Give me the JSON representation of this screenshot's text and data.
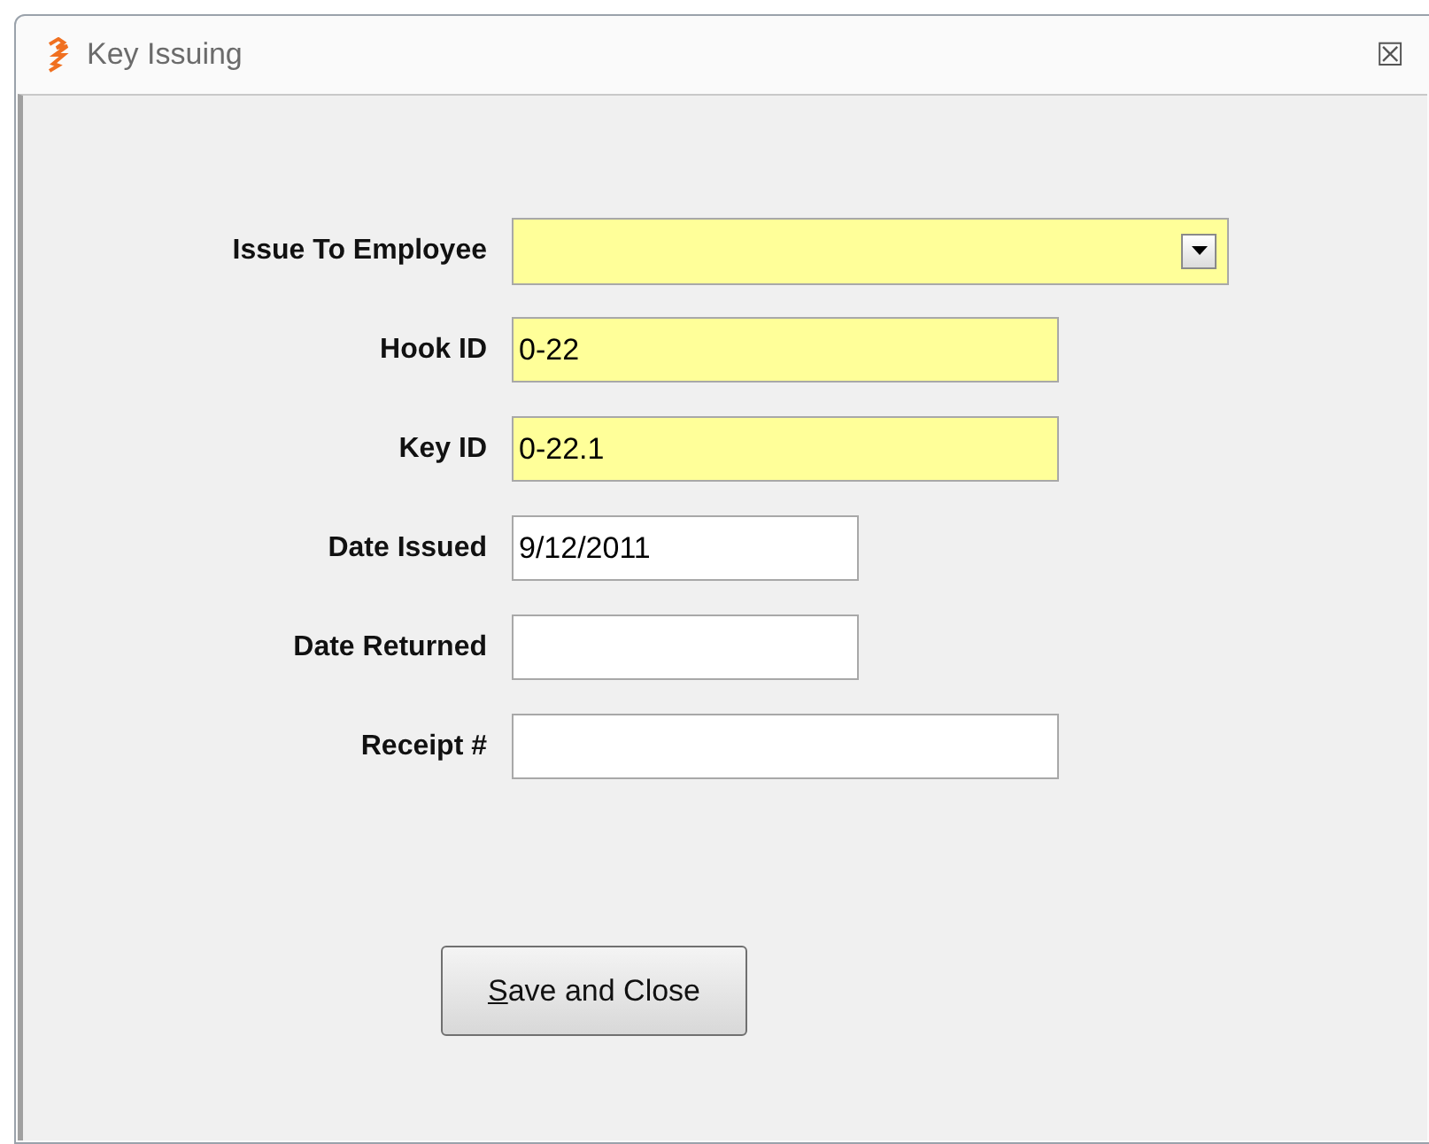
{
  "window": {
    "title": "Key Issuing",
    "close": "☒"
  },
  "fields": [
    {
      "kind": "combo",
      "label": "Issue To Employee",
      "highlighted": true
    },
    {
      "kind": "text",
      "label": "Hook ID",
      "value": "0-22",
      "highlighted": true
    },
    {
      "kind": "text",
      "label": "Key ID",
      "value": "0-22.1",
      "highlighted": true
    },
    {
      "kind": "text",
      "label": "Date Issued",
      "value": "9/12/2011",
      "highlighted": false
    },
    {
      "kind": "text",
      "label": "Date Returned",
      "highlighted": false
    },
    {
      "kind": "text",
      "label": "Receipt #",
      "highlighted": false
    }
  ],
  "button": {
    "label": "Save and Close"
  }
}
